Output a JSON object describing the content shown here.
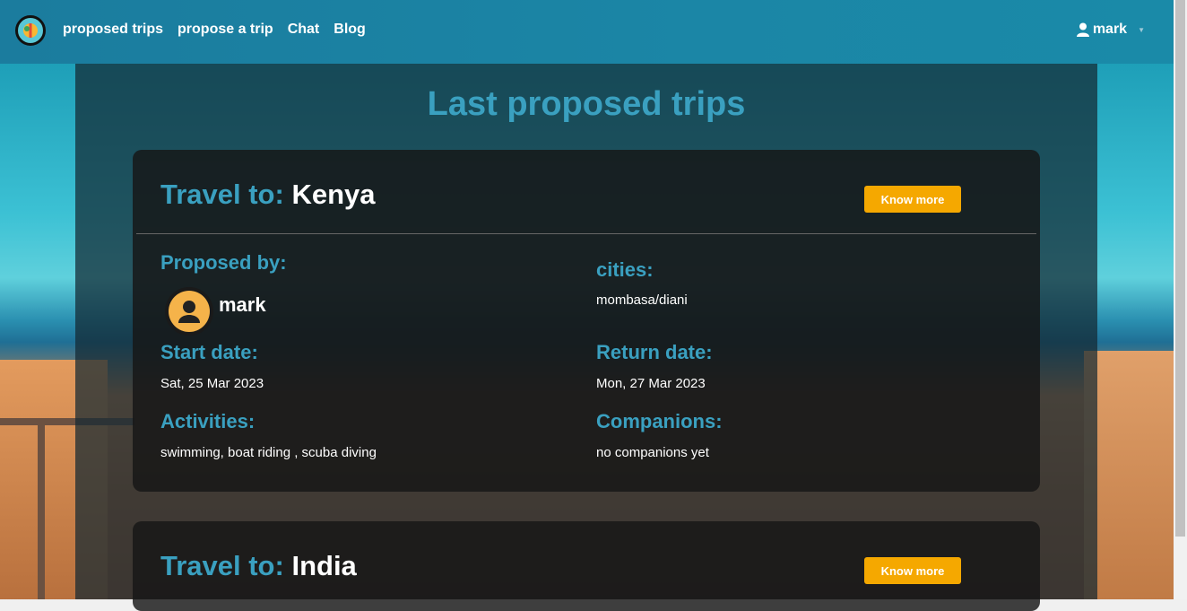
{
  "nav": {
    "links": [
      "proposed trips",
      "propose a trip",
      "Chat",
      "Blog"
    ],
    "user": "mark"
  },
  "page_title": "Last proposed trips",
  "trips": [
    {
      "travel_label": "Travel to:",
      "destination": "Kenya",
      "button": "Know more",
      "proposed_by_label": "Proposed by:",
      "author": "mark",
      "cities_label": "cities:",
      "cities": "mombasa/diani",
      "start_label": "Start date:",
      "start_date": "Sat, 25 Mar 2023",
      "return_label": "Return date:",
      "return_date": "Mon, 27 Mar 2023",
      "activities_label": "Activities:",
      "activities": "swimming, boat riding , scuba diving",
      "companions_label": "Companions:",
      "companions": "no companions yet"
    },
    {
      "travel_label": "Travel to:",
      "destination": "India",
      "button": "Know more"
    }
  ],
  "colors": {
    "accent": "#3aa0c0",
    "button": "#f5a800",
    "navbar": "#1b86a6"
  }
}
